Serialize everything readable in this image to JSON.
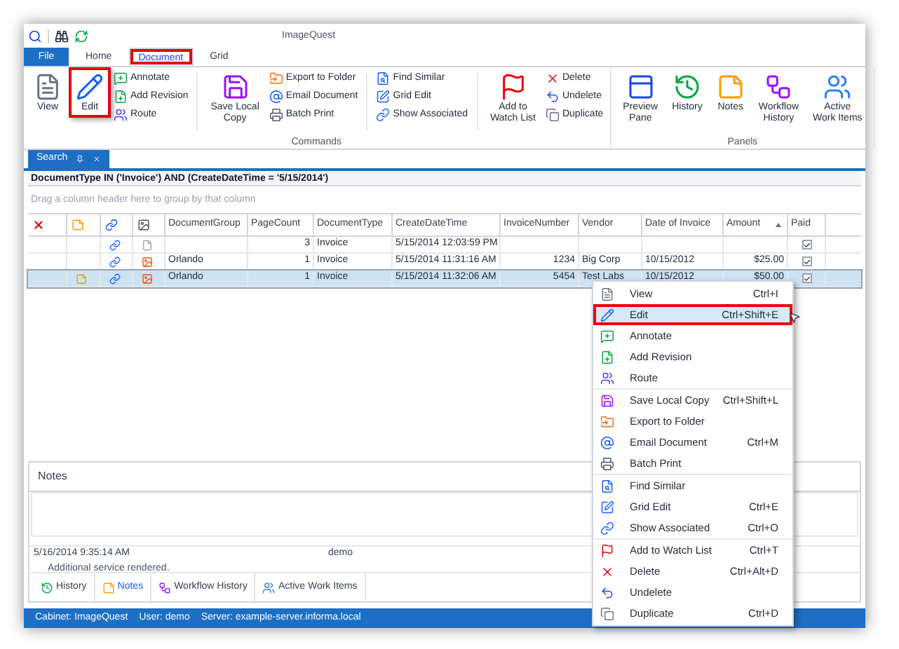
{
  "window": {
    "title": "ImageQuest"
  },
  "ribbon_tabs": [
    {
      "label": "File",
      "kind": "file",
      "selected": false,
      "highlighted": false
    },
    {
      "label": "Home",
      "kind": "tab",
      "selected": false,
      "highlighted": false
    },
    {
      "label": "Document",
      "kind": "tab",
      "selected": true,
      "highlighted": true
    },
    {
      "label": "Grid",
      "kind": "tab",
      "selected": false,
      "highlighted": false
    }
  ],
  "ribbon": {
    "groups": [
      {
        "label": "Commands",
        "columns": [
          {
            "kind": "large",
            "lines": [
              "View"
            ],
            "highlighted": false
          },
          {
            "kind": "large",
            "lines": [
              "Edit"
            ],
            "highlighted": true
          },
          {
            "kind": "stack",
            "items": [
              "Annotate",
              "Add Revision",
              "Route"
            ]
          },
          {
            "kind": "separator"
          },
          {
            "kind": "large",
            "lines": [
              "Save Local",
              "Copy"
            ],
            "highlighted": false
          },
          {
            "kind": "stack",
            "items": [
              "Export to Folder",
              "Email Document",
              "Batch Print"
            ]
          },
          {
            "kind": "separator"
          },
          {
            "kind": "stack",
            "items": [
              "Find Similar",
              "Grid Edit",
              "Show Associated"
            ]
          },
          {
            "kind": "separator"
          },
          {
            "kind": "large",
            "lines": [
              "Add to",
              "Watch List"
            ],
            "highlighted": false
          },
          {
            "kind": "stack",
            "items": [
              "Delete",
              "Undelete",
              "Duplicate"
            ]
          }
        ]
      },
      {
        "label": "Panels",
        "columns": [
          {
            "kind": "large",
            "lines": [
              "Preview",
              "Pane"
            ],
            "highlighted": false
          },
          {
            "kind": "large",
            "lines": [
              "History"
            ],
            "highlighted": false
          },
          {
            "kind": "large",
            "lines": [
              "Notes"
            ],
            "highlighted": false
          },
          {
            "kind": "large",
            "lines": [
              "Workflow",
              "History"
            ],
            "highlighted": false
          },
          {
            "kind": "large",
            "lines": [
              "Active",
              "Work Items"
            ],
            "highlighted": false
          }
        ]
      }
    ]
  },
  "document_tab": {
    "label": "Search"
  },
  "filter": "DocumentType IN ('Invoice') AND (CreateDateTime = '5/15/2014')",
  "group_panel_hint": "Drag a column header here to group by that column",
  "table": {
    "columns": [
      {
        "label": "DocumentGroup",
        "sorted": false
      },
      {
        "label": "PageCount",
        "sorted": false
      },
      {
        "label": "DocumentType",
        "sorted": false
      },
      {
        "label": "CreateDateTime",
        "sorted": false
      },
      {
        "label": "InvoiceNumber",
        "sorted": false
      },
      {
        "label": "Vendor",
        "sorted": false
      },
      {
        "label": "Date of Invoice",
        "sorted": false
      },
      {
        "label": "Amount",
        "sorted": true
      },
      {
        "label": "Paid",
        "sorted": false
      }
    ],
    "rows": [
      {
        "selected": false,
        "note": false,
        "kind": "blank",
        "cells": [
          "",
          "3",
          "Invoice",
          "5/15/2014 12:03:59 PM",
          "",
          "",
          "",
          ""
        ],
        "paid": true
      },
      {
        "selected": false,
        "note": false,
        "kind": "image",
        "cells": [
          "Orlando",
          "1",
          "Invoice",
          "5/15/2014 11:31:16 AM",
          "1234",
          "Big Corp",
          "10/15/2012",
          "$25.00"
        ],
        "paid": true
      },
      {
        "selected": true,
        "note": true,
        "kind": "image",
        "cells": [
          "Orlando",
          "1",
          "Invoice",
          "5/15/2014 11:32:06 AM",
          "5454",
          "Test Labs",
          "10/15/2012",
          "$50.00"
        ],
        "paid": true
      }
    ]
  },
  "notes_panel": {
    "title": "Notes",
    "entries": [
      {
        "date": "5/16/2014 9:35:14 AM",
        "user": "demo",
        "text": "Additional service rendered."
      }
    ]
  },
  "panel_tabs": [
    {
      "label": "History",
      "selected": false
    },
    {
      "label": "Notes",
      "selected": true
    },
    {
      "label": "Workflow History",
      "selected": false
    },
    {
      "label": "Active Work Items",
      "selected": false
    }
  ],
  "context_menu": {
    "groups": [
      [
        {
          "label": "View",
          "shortcut": "Ctrl+I",
          "highlighted": false
        },
        {
          "label": "Edit",
          "shortcut": "Ctrl+Shift+E",
          "highlighted": true
        },
        {
          "label": "Annotate",
          "highlighted": false
        },
        {
          "label": "Add Revision",
          "highlighted": false
        },
        {
          "label": "Route",
          "highlighted": false
        }
      ],
      [
        {
          "label": "Save Local Copy",
          "shortcut": "Ctrl+Shift+L",
          "highlighted": false
        },
        {
          "label": "Export to Folder",
          "highlighted": false
        },
        {
          "label": "Email Document",
          "shortcut": "Ctrl+M",
          "highlighted": false
        },
        {
          "label": "Batch Print",
          "highlighted": false
        }
      ],
      [
        {
          "label": "Find Similar",
          "highlighted": false
        },
        {
          "label": "Grid Edit",
          "shortcut": "Ctrl+E",
          "highlighted": false
        },
        {
          "label": "Show Associated",
          "shortcut": "Ctrl+O",
          "highlighted": false
        }
      ],
      [
        {
          "label": "Add to Watch List",
          "shortcut": "Ctrl+T",
          "highlighted": false
        },
        {
          "label": "Delete",
          "shortcut": "Ctrl+Alt+D",
          "highlighted": false
        },
        {
          "label": "Undelete",
          "highlighted": false
        },
        {
          "label": "Duplicate",
          "shortcut": "Ctrl+D",
          "highlighted": false
        }
      ]
    ]
  },
  "status_bar": [
    "Cabinet: ImageQuest",
    "User: demo",
    "Server: example-server.informa.local"
  ]
}
